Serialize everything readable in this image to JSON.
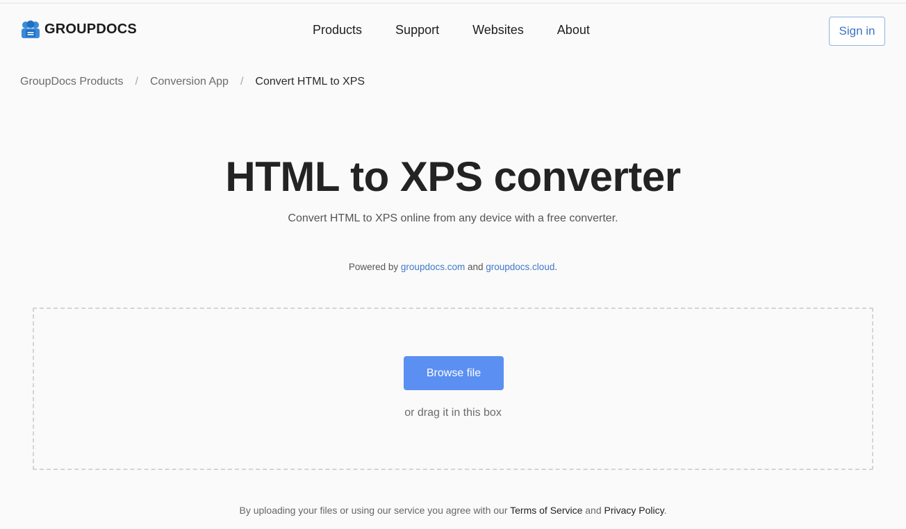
{
  "header": {
    "logo_text": "GROUPDOCS",
    "logo_icon": "groupdocs-logo-icon",
    "nav": [
      "Products",
      "Support",
      "Websites",
      "About"
    ],
    "signin_label": "Sign in"
  },
  "breadcrumb": {
    "items": [
      "GroupDocs Products",
      "Conversion App",
      "Convert HTML to XPS"
    ],
    "separator": "/"
  },
  "main": {
    "title": "HTML to XPS converter",
    "subtitle": "Convert HTML to XPS online from any device with a free converter.",
    "powered": {
      "prefix": "Powered by ",
      "link1": "groupdocs.com",
      "middle": " and ",
      "link2": "groupdocs.cloud",
      "suffix": "."
    },
    "dropzone": {
      "browse_label": "Browse file",
      "drag_text": "or drag it in this box"
    }
  },
  "footer": {
    "prefix": "By uploading your files or using our service you agree with our ",
    "terms": "Terms of Service",
    "middle": " and ",
    "privacy": "Privacy Policy",
    "suffix": "."
  },
  "colors": {
    "accent": "#5b8ff2",
    "link": "#3f78c8",
    "logo_blue": "#3a8ad8"
  }
}
